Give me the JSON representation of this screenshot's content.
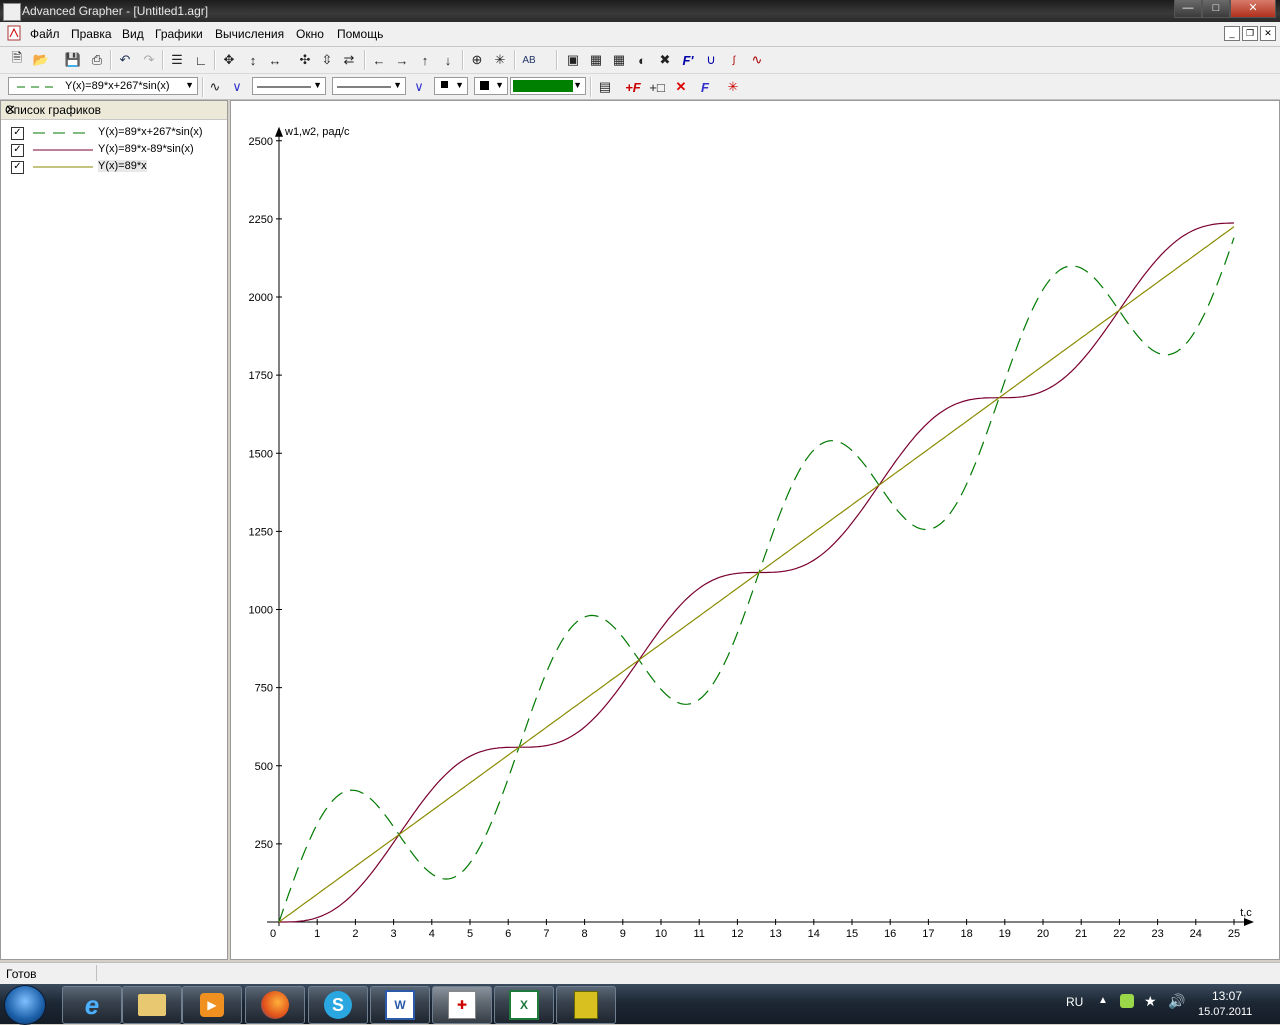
{
  "window": {
    "title": "Advanced Grapher - [Untitled1.agr]"
  },
  "menu": {
    "items": [
      "Файл",
      "Правка",
      "Вид",
      "Графики",
      "Вычисления",
      "Окно",
      "Помощь"
    ]
  },
  "toolbar2": {
    "formula_combo": "Y(x)=89*x+267*sin(x)",
    "color_swatch": "#008000"
  },
  "graph_list": {
    "title": "Список графиков",
    "items": [
      {
        "label": "Y(x)=89*x+267*sin(x)",
        "checked": true,
        "color": "#007a00",
        "dash": "dashed"
      },
      {
        "label": "Y(x)=89*x-89*sin(x)",
        "checked": true,
        "color": "#7a0030",
        "dash": "solid"
      },
      {
        "label": "Y(x)=89*x",
        "checked": true,
        "color": "#8a8a00",
        "dash": "solid"
      }
    ]
  },
  "chart_data": {
    "type": "line",
    "ylabel": "w1,w2, рад/с",
    "xlabel": "t,c",
    "xlim": [
      0,
      25
    ],
    "ylim": [
      0,
      2500
    ],
    "x_ticks": [
      "0",
      "1",
      "2",
      "3",
      "4",
      "5",
      "6",
      "7",
      "8",
      "9",
      "10",
      "11",
      "12",
      "13",
      "14",
      "15",
      "16",
      "17",
      "18",
      "19",
      "20",
      "21",
      "22",
      "23",
      "24",
      "25"
    ],
    "y_ticks": [
      "250",
      "500",
      "750",
      "1000",
      "1250",
      "1500",
      "1750",
      "2000",
      "2250",
      "2500"
    ],
    "grid": false,
    "series": [
      {
        "name": "Y(x)=89*x+267*sin(x)",
        "formula": "89*x+267*sin(x)",
        "color": "#007a00",
        "style": "dashed"
      },
      {
        "name": "Y(x)=89*x-89*sin(x)",
        "formula": "89*x-89*sin(x)",
        "color": "#7a0030",
        "style": "solid"
      },
      {
        "name": "Y(x)=89*x",
        "formula": "89*x",
        "color": "#8a8a00",
        "style": "solid"
      }
    ]
  },
  "status": {
    "text": "Готов"
  },
  "taskbar": {
    "apps": [
      "internet-explorer",
      "file-explorer",
      "media-player",
      "firefox",
      "skype",
      "word",
      "advanced-grapher",
      "excel",
      "network-app"
    ],
    "lang": "RU",
    "time": "13:07",
    "date": "15.07.2011"
  }
}
